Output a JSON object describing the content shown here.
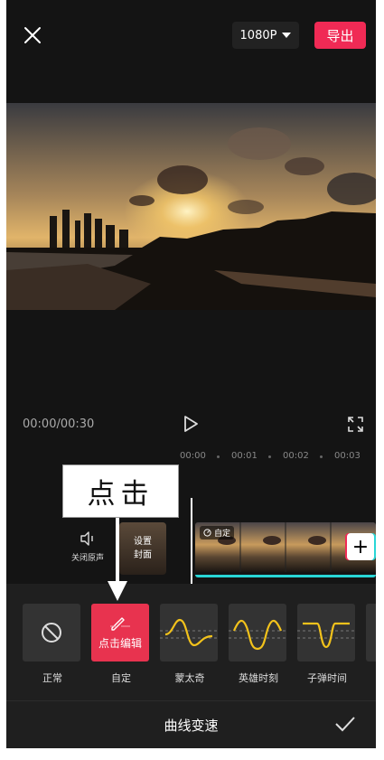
{
  "topbar": {
    "resolution": "1080P",
    "export_label": "导出"
  },
  "player": {
    "time": "00:00/00:30"
  },
  "timeline": {
    "ticks": [
      "00:00",
      "00:01",
      "00:02",
      "00:03"
    ],
    "mute_label": "关闭原声",
    "cover_label_line1": "设置",
    "cover_label_line2": "封面",
    "clip_tag": "自定"
  },
  "annotation": {
    "callout": "点击"
  },
  "speed_curves": {
    "presets": [
      {
        "label": "正常",
        "icon": "ban-icon"
      },
      {
        "label": "自定",
        "icon": "pencil-icon",
        "button_text": "点击编辑",
        "selected": true
      },
      {
        "label": "蒙太奇",
        "icon": "curve-icon"
      },
      {
        "label": "英雄时刻",
        "icon": "curve-icon"
      },
      {
        "label": "子弹时间",
        "icon": "curve-icon"
      }
    ],
    "title": "曲线变速"
  },
  "colors": {
    "accent": "#f02a55",
    "curve": "#f2c21b",
    "clip_edge": "#29d6d6"
  }
}
